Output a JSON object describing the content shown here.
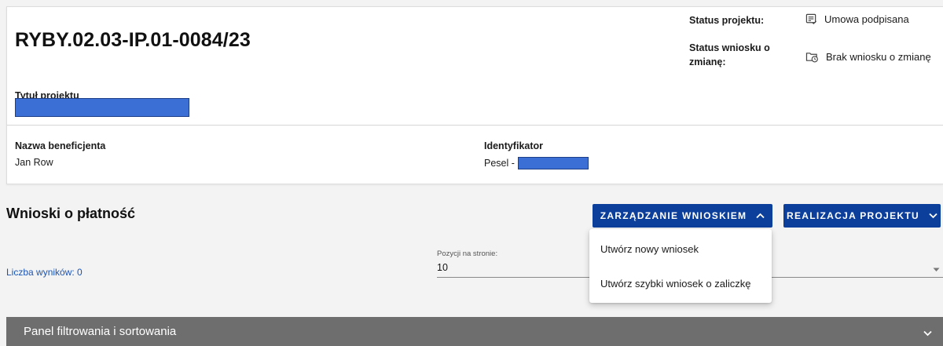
{
  "project": {
    "number": "RYBY.02.03-IP.01-0084/23",
    "title_label": "Tytuł projektu"
  },
  "status": {
    "project_label": "Status projektu:",
    "project_value": "Umowa podpisana",
    "project_icon": "document-check-icon",
    "change_label_line1": "Status wniosku o",
    "change_label_line2": "zmianę:",
    "change_value": "Brak wniosku o zmianę",
    "change_icon": "folder-clock-icon"
  },
  "beneficiary": {
    "label": "Nazwa beneficjenta",
    "value": "Jan Row"
  },
  "identifier": {
    "label": "Identyfikator",
    "prefix": "Pesel -"
  },
  "payments": {
    "title": "Wnioski o płatność",
    "manage_button": "ZARZĄDZANIE WNIOSKIEM",
    "realization_button": "REALIZACJA PROJEKTU",
    "results_label": "Liczba wyników: 0",
    "page_size_label": "Pozycji na stronie:",
    "page_size_value": "10"
  },
  "dropdown": {
    "items": [
      "Utwórz nowy wniosek",
      "Utwórz szybki wniosek o zaliczkę"
    ]
  },
  "filter_panel": {
    "label": "Panel filtrowania i sortowania"
  },
  "colors": {
    "primary": "#0c3f9b",
    "link": "#1b55b3",
    "panel": "#6e6e6e",
    "redaction": "#3b6fd6"
  }
}
